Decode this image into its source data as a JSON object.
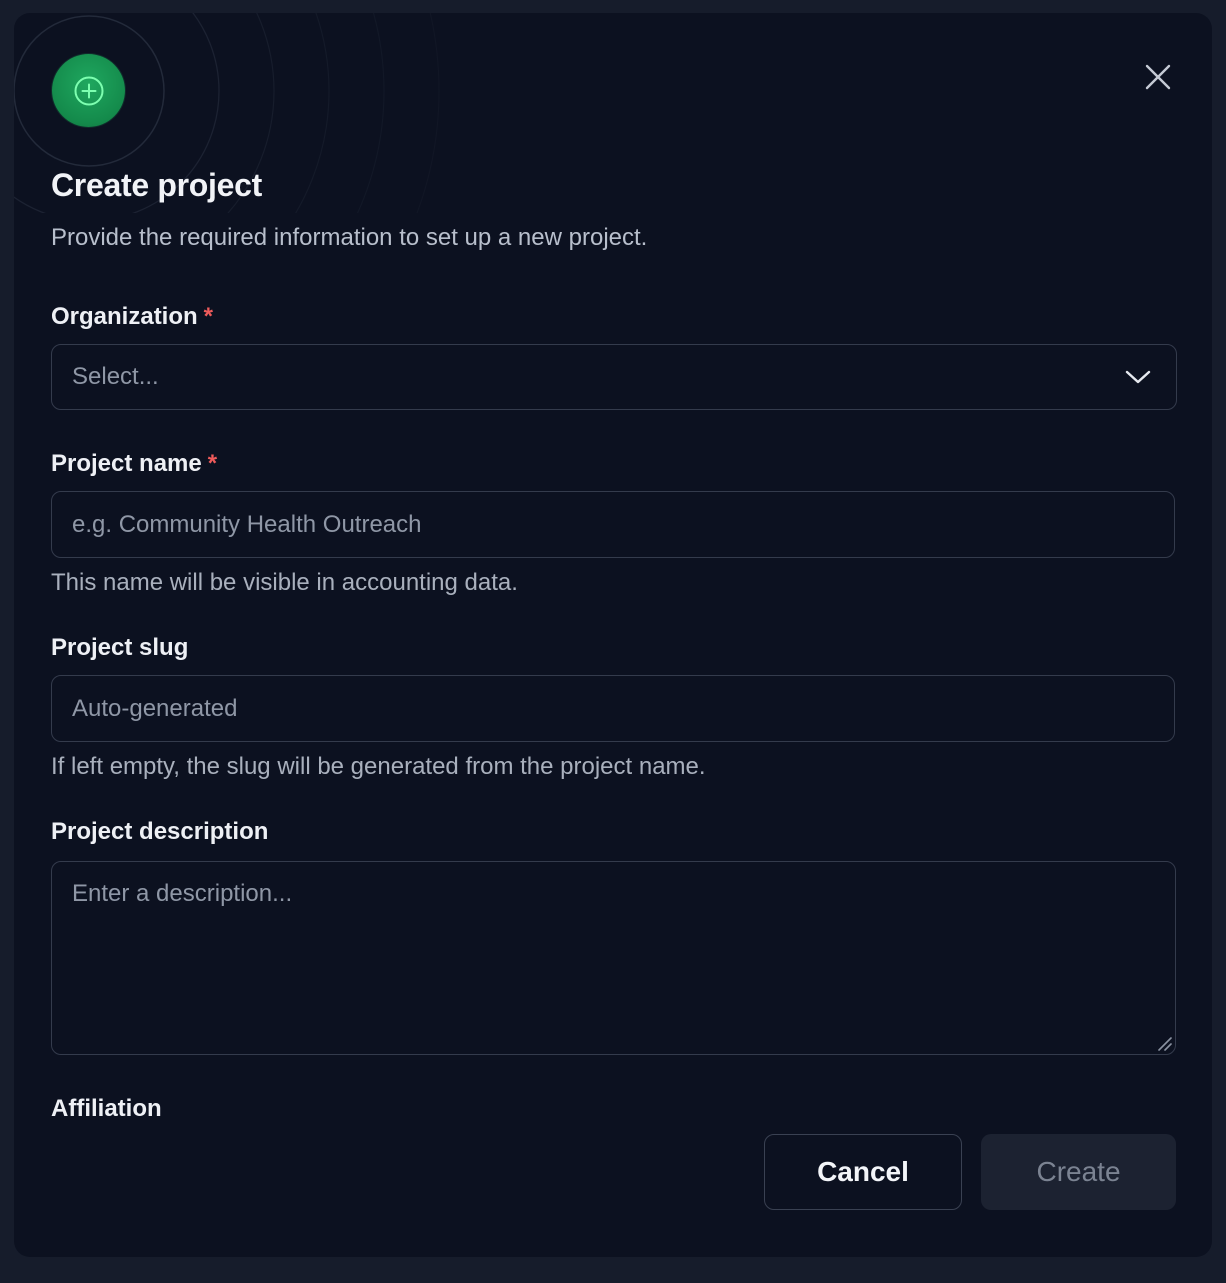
{
  "dialog": {
    "title": "Create project",
    "subtitle": "Provide the required information to set up a new project.",
    "header_icon": "plus-circle-icon",
    "close_icon": "close-icon",
    "accent_color": "#148a4b"
  },
  "form": {
    "organization": {
      "label": "Organization",
      "required_mark": "*",
      "placeholder": "Select...",
      "icon": "chevron-down-icon"
    },
    "project_name": {
      "label": "Project name",
      "required_mark": "*",
      "placeholder": "e.g. Community Health Outreach",
      "hint": "This name will be visible in accounting data."
    },
    "project_slug": {
      "label": "Project slug",
      "placeholder": "Auto-generated",
      "hint": "If left empty, the slug will be generated from the project name."
    },
    "project_description": {
      "label": "Project description",
      "placeholder": "Enter a description..."
    },
    "affiliation": {
      "label": "Affiliation"
    }
  },
  "actions": {
    "cancel_label": "Cancel",
    "create_label": "Create"
  }
}
